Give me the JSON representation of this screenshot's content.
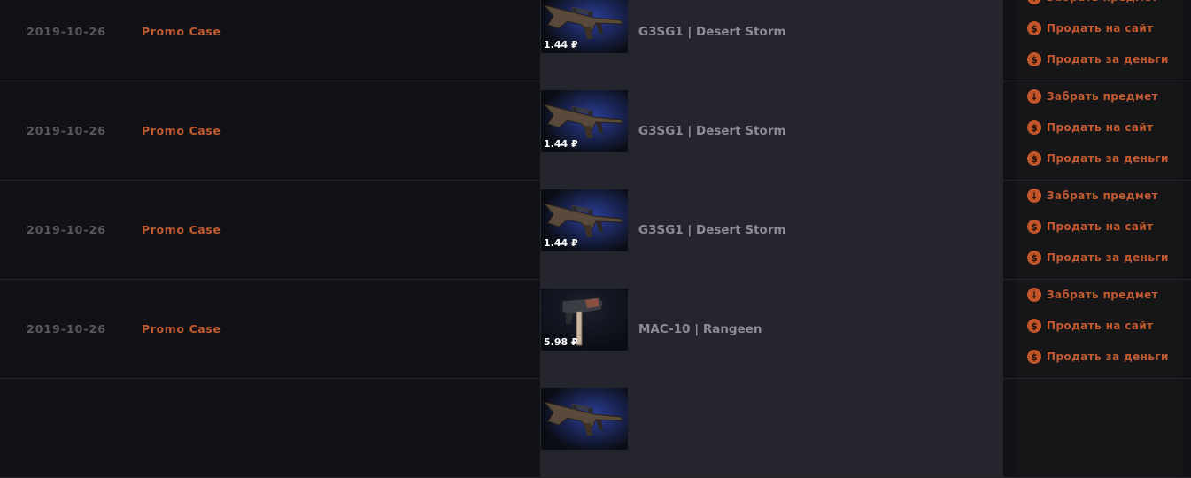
{
  "colors": {
    "background": "#121217",
    "row_background": "#111116",
    "item_panel": "#25252d",
    "accent": "#c25a30",
    "date_text": "#595961",
    "item_text": "#8c8c94"
  },
  "action_icons": [
    "download-arrow-icon",
    "dollar-icon",
    "dollar-icon"
  ],
  "rows": [
    {
      "date": "2019-10-26",
      "case_name": "Promo Case",
      "item_name": "G3SG1 | Desert Storm",
      "price": "1.44 ₽",
      "weapon": "rifle",
      "actions": [
        "Забрать предмет",
        "Продать на сайт",
        "Продать за деньги"
      ]
    },
    {
      "date": "2019-10-26",
      "case_name": "Promo Case",
      "item_name": "G3SG1 | Desert Storm",
      "price": "1.44 ₽",
      "weapon": "rifle",
      "actions": [
        "Забрать предмет",
        "Продать на сайт",
        "Продать за деньги"
      ]
    },
    {
      "date": "2019-10-26",
      "case_name": "Promo Case",
      "item_name": "G3SG1 | Desert Storm",
      "price": "1.44 ₽",
      "weapon": "rifle",
      "actions": [
        "Забрать предмет",
        "Продать на сайт",
        "Продать за деньги"
      ]
    },
    {
      "date": "2019-10-26",
      "case_name": "Promo Case",
      "item_name": "MAC-10 | Rangeen",
      "price": "5.98 ₽",
      "weapon": "smg",
      "actions": [
        "Забрать предмет",
        "Продать на сайт",
        "Продать за деньги"
      ]
    },
    {
      "date": "",
      "case_name": "",
      "item_name": "",
      "price": "",
      "weapon": "rifle",
      "actions": []
    }
  ]
}
